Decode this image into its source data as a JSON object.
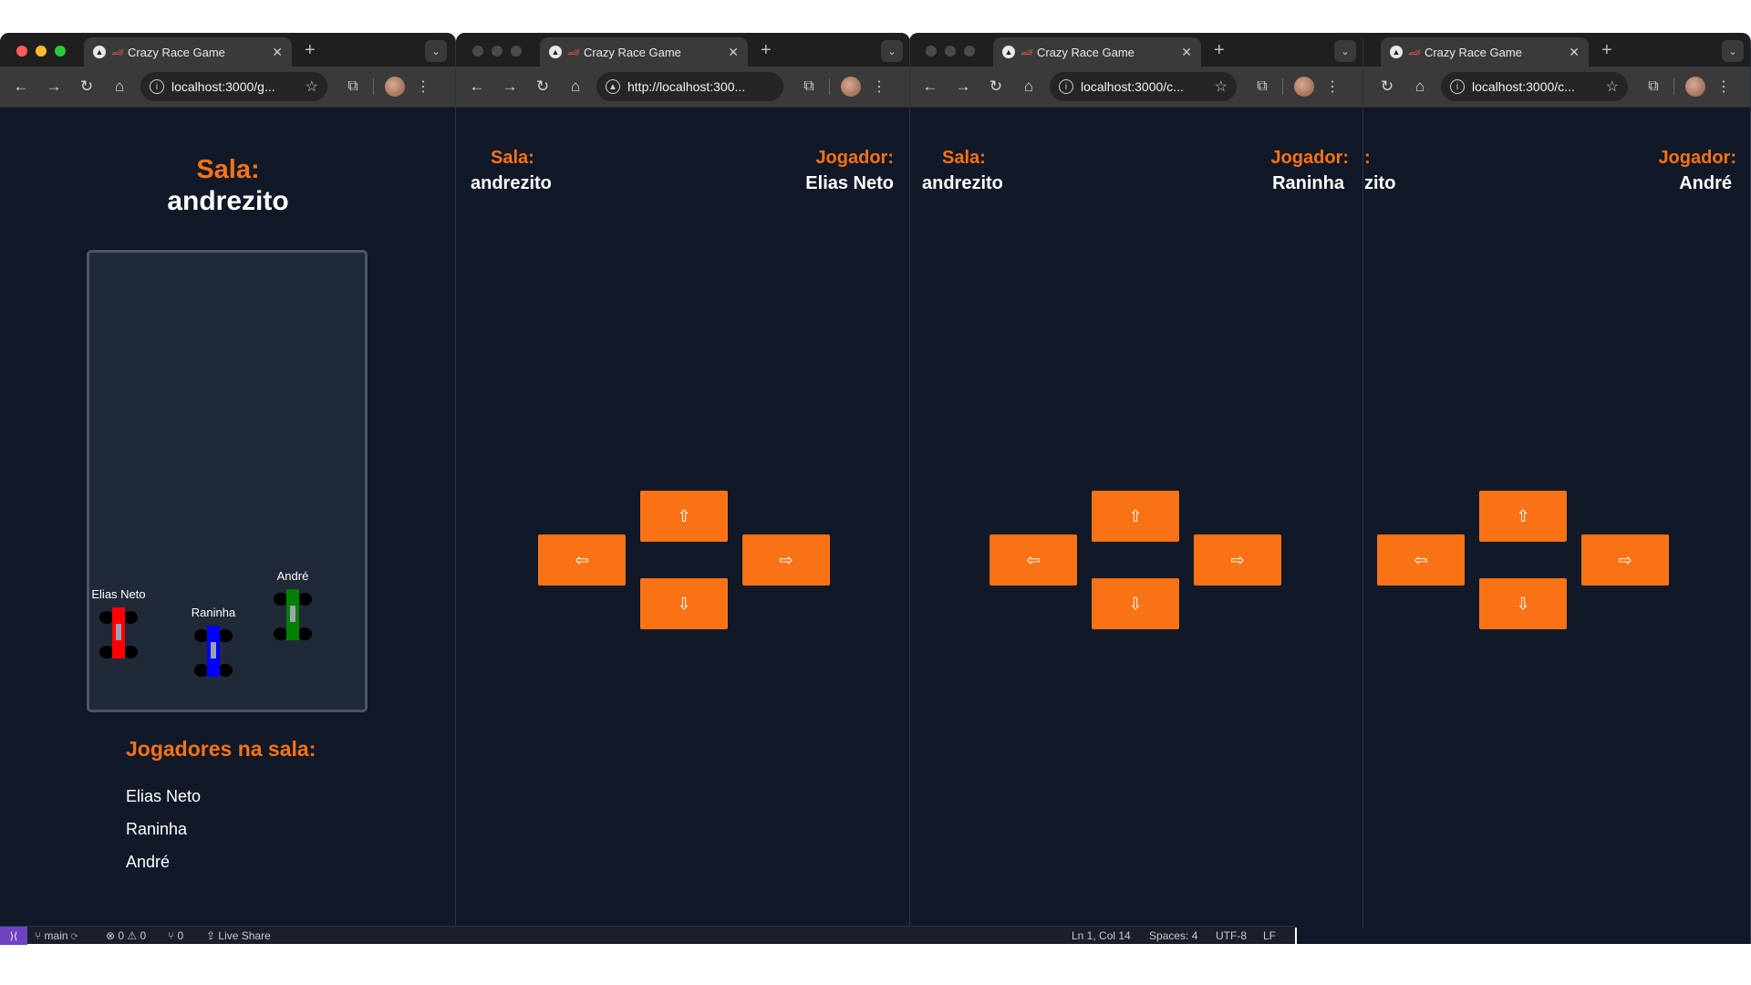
{
  "browser": {
    "tab_title": "Crazy Race Game",
    "urls": [
      "localhost:3000/g...",
      "http://localhost:300...",
      "localhost:3000/c...",
      "localhost:3000/c..."
    ]
  },
  "host": {
    "room_label": "Sala:",
    "room_name": "andrezito",
    "players_heading": "Jogadores na sala:",
    "players": [
      "Elias Neto",
      "Raninha",
      "André"
    ],
    "cars": [
      {
        "name": "Elias Neto",
        "color": "#ff0000"
      },
      {
        "name": "Raninha",
        "color": "#0000ff"
      },
      {
        "name": "André",
        "color": "#008000"
      }
    ]
  },
  "controllers": [
    {
      "room_label": "Sala:",
      "room_name": "andrezito",
      "player_label": "Jogador:",
      "player_name": "Elias Neto"
    },
    {
      "room_label": "Sala:",
      "room_name": "andrezito",
      "player_label": "Jogador:",
      "player_name": "Raninha"
    },
    {
      "room_label": ":",
      "room_name": "zito",
      "player_label": "Jogador:",
      "player_name": "André"
    }
  ],
  "controls": {
    "up": "⇧",
    "left": "⇦",
    "right": "⇨",
    "down": "⇩"
  },
  "statusbar": {
    "branch": "main",
    "problems": "⊗ 0 ⚠ 0",
    "ports": "⑂ 0",
    "live_share": "Live Share",
    "cursor": "Ln 1, Col 14",
    "spaces": "Spaces: 4",
    "encoding": "UTF-8",
    "eol": "LF"
  },
  "colors": {
    "accent": "#f97316",
    "background": "#111827",
    "track": "#1f2937"
  }
}
